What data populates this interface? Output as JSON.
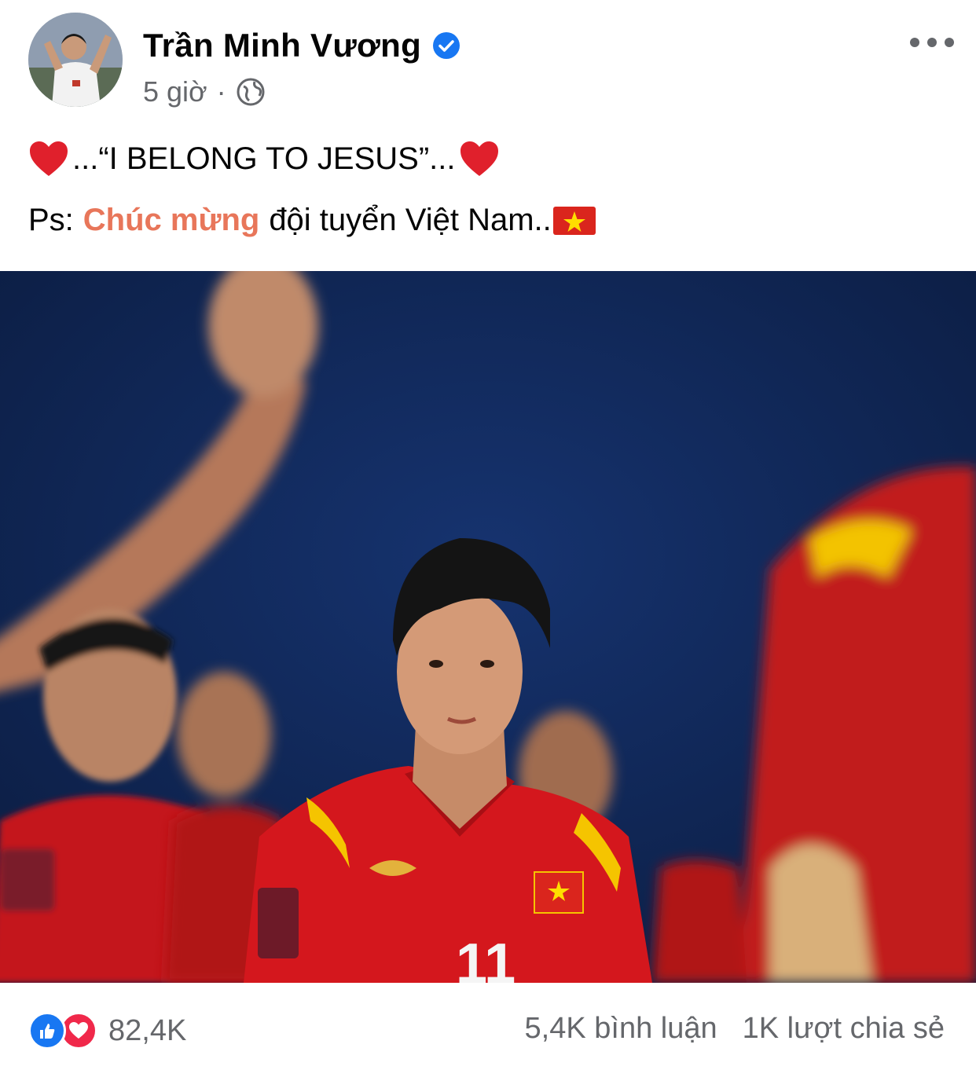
{
  "post": {
    "author": "Trần Minh Vương",
    "time": "5 giờ",
    "separator": "·",
    "line1_open": "...“I BELONG TO JESUS”...",
    "line2_prefix": "Ps:",
    "line2_highlight": "Chúc mừng",
    "line2_rest": "đội tuyển Việt Nam..",
    "image_jersey_number": "11"
  },
  "icons": {
    "verified": "verified-badge-icon",
    "privacy": "globe-icon",
    "more": "more-options-icon",
    "heart_emoji": "red-heart-emoji",
    "flag_emoji": "vietnam-flag-emoji",
    "like": "like-reaction-icon",
    "love": "love-reaction-icon"
  },
  "colors": {
    "highlight": "#e8765a",
    "verified": "#1877f2",
    "like": "#1877f2",
    "love": "#f0284a",
    "meta": "#65676b"
  },
  "footer": {
    "reactions_count": "82,4K",
    "comments": "5,4K bình luận",
    "shares": "1K lượt chia sẻ"
  }
}
